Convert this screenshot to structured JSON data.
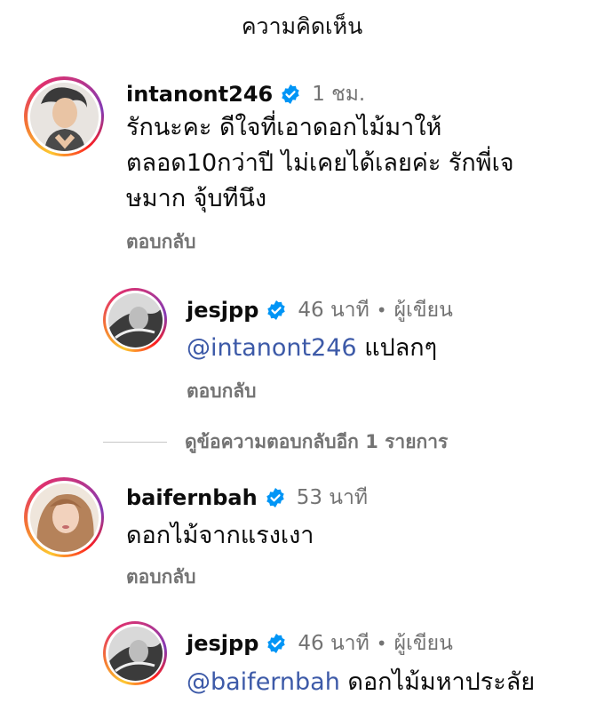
{
  "header": {
    "title": "ความคิดเห็น"
  },
  "comments": [
    {
      "username": "intanont246",
      "time": "1 ชม.",
      "lines": [
        "รักนะคะ ดีใจที่เอาดอกไม้มาให้",
        "ตลอด10กว่าปี ไม่เคยได้เลยค่ะ รักพี่เจ",
        "ษมาก จุ้บทีนึง"
      ],
      "reply_label": "ตอบกลับ"
    },
    {
      "username": "jesjpp",
      "time": "46 นาที",
      "author_tag": "ผู้เขียน",
      "mention": "@intanont246",
      "text": " แปลกๆ",
      "reply_label": "ตอบกลับ"
    },
    {
      "username": "baifernbah",
      "time": "53 นาที",
      "text": "ดอกไม้จากแรงเงา",
      "reply_label": "ตอบกลับ"
    },
    {
      "username": "jesjpp",
      "time": "46 นาที",
      "author_tag": "ผู้เขียน",
      "mention": "@baifernbah",
      "text": " ดอกไม้มหาประลัย"
    }
  ],
  "more_replies": "ดูข้อความตอบกลับอีก 1 รายการ",
  "colors": {
    "verified": "#0095f6",
    "mention": "#3d5aa8",
    "muted": "#737373"
  }
}
